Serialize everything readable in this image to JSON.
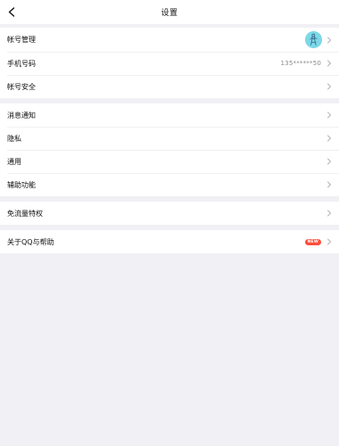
{
  "header": {
    "title": "设置"
  },
  "groups": [
    {
      "items": [
        {
          "label": "帐号管理"
        },
        {
          "label": "手机号码",
          "value": "135******50"
        },
        {
          "label": "帐号安全"
        }
      ]
    },
    {
      "items": [
        {
          "label": "消息通知"
        },
        {
          "label": "隐私"
        },
        {
          "label": "通用"
        },
        {
          "label": "辅助功能"
        }
      ]
    },
    {
      "items": [
        {
          "label": "免流量特权"
        }
      ]
    },
    {
      "items": [
        {
          "label": "关于QQ与帮助",
          "badge": "NEW"
        }
      ]
    }
  ],
  "colors": {
    "background": "#f0f0f5",
    "avatar": "#7dd8e8",
    "badge": "#ff4d3a",
    "value_text": "#8a8a8f"
  },
  "icons": {
    "back": "back-arrow-icon",
    "chevron": "chevron-right-icon"
  }
}
